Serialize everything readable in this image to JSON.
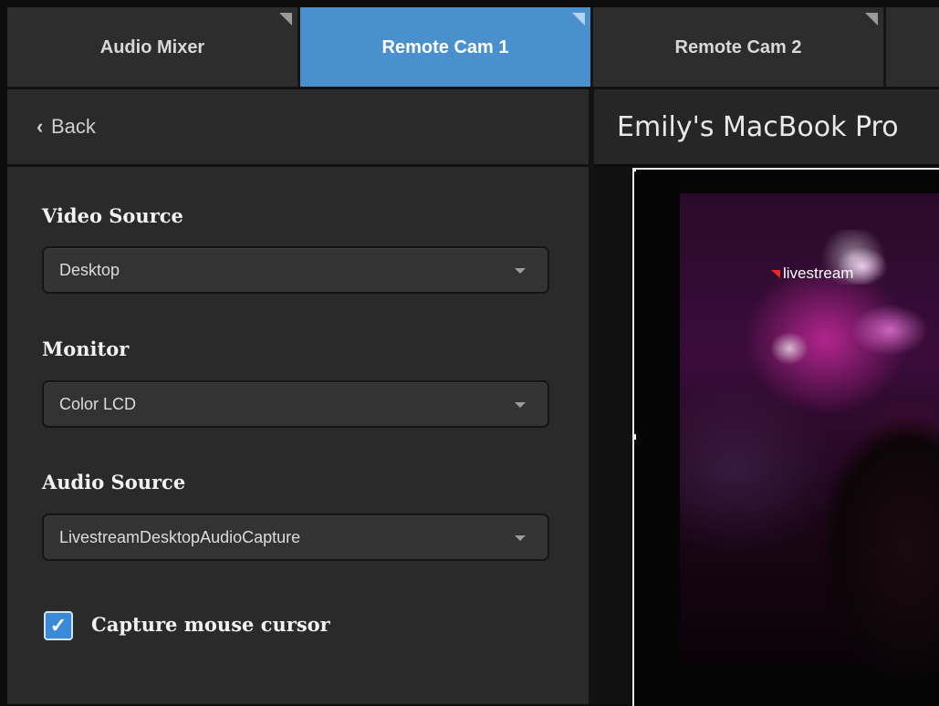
{
  "tabs": [
    {
      "label": "Audio Mixer",
      "active": false
    },
    {
      "label": "Remote Cam 1",
      "active": true
    },
    {
      "label": "Remote Cam 2",
      "active": false
    }
  ],
  "left_panel": {
    "back_label": "Back",
    "back_icon": "chevron-left-icon",
    "video_source": {
      "label": "Video Source",
      "value": "Desktop"
    },
    "monitor": {
      "label": "Monitor",
      "value": "Color LCD"
    },
    "audio_source": {
      "label": "Audio Source",
      "value": "LivestreamDesktopAudioCapture"
    },
    "capture_cursor": {
      "label": "Capture mouse cursor",
      "checked": true
    }
  },
  "right_panel": {
    "device_name": "Emily's MacBook Pro",
    "preview": {
      "logo_text": "livestream"
    }
  },
  "colors": {
    "accent": "#4a90ce",
    "panel_bg": "#2a2a2a",
    "checkbox": "#3b8ad8",
    "logo_red": "#e8272d"
  }
}
